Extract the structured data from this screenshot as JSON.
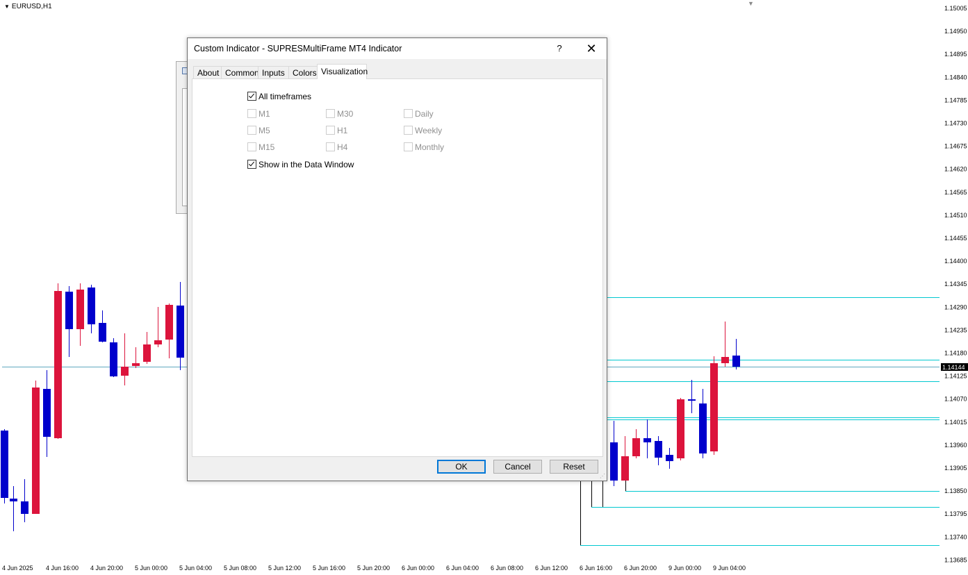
{
  "chart": {
    "symbol": "EURUSD,H1",
    "price_labels": [
      "1.15005",
      "1.14950",
      "1.14895",
      "1.14840",
      "1.14785",
      "1.14730",
      "1.14675",
      "1.14620",
      "1.14565",
      "1.14510",
      "1.14455",
      "1.14400",
      "1.14345",
      "1.14290",
      "1.14235",
      "1.14180",
      "1.14125",
      "1.14070",
      "1.14015",
      "1.13960",
      "1.13905",
      "1.13850",
      "1.13795",
      "1.13740",
      "1.13685"
    ],
    "current_price": "1.14144",
    "time_labels": [
      "4 Jun 2025",
      "4 Jun 16:00",
      "4 Jun 20:00",
      "5 Jun 00:00",
      "5 Jun 04:00",
      "5 Jun 08:00",
      "5 Jun 12:00",
      "5 Jun 16:00",
      "5 Jun 20:00",
      "6 Jun 00:00",
      "6 Jun 04:00",
      "6 Jun 08:00",
      "6 Jun 12:00",
      "6 Jun 16:00",
      "6 Jun 20:00",
      "9 Jun 00:00",
      "9 Jun 04:00"
    ],
    "colors": {
      "bull": "#0000cc",
      "bear": "#dc143c",
      "level": "#00c8d0",
      "bid": "#5fa8c0"
    }
  },
  "dialog": {
    "title": "Custom Indicator - SUPRESMultiFrame MT4 Indicator",
    "help": "?",
    "close": "✕",
    "tabs": [
      "About",
      "Common",
      "Inputs",
      "Colors",
      "Visualization"
    ],
    "active_tab": "Visualization",
    "all_timeframes": {
      "label": "All timeframes",
      "checked": true
    },
    "timeframes": [
      {
        "label": "M1",
        "checked": false
      },
      {
        "label": "M30",
        "checked": false
      },
      {
        "label": "Daily",
        "checked": false
      },
      {
        "label": "M5",
        "checked": false
      },
      {
        "label": "H1",
        "checked": false
      },
      {
        "label": "Weekly",
        "checked": false
      },
      {
        "label": "M15",
        "checked": false
      },
      {
        "label": "H4",
        "checked": false
      },
      {
        "label": "Monthly",
        "checked": false
      }
    ],
    "show_data_window": {
      "label": "Show in the Data Window",
      "checked": true
    },
    "buttons": {
      "ok": "OK",
      "cancel": "Cancel",
      "reset": "Reset"
    }
  }
}
